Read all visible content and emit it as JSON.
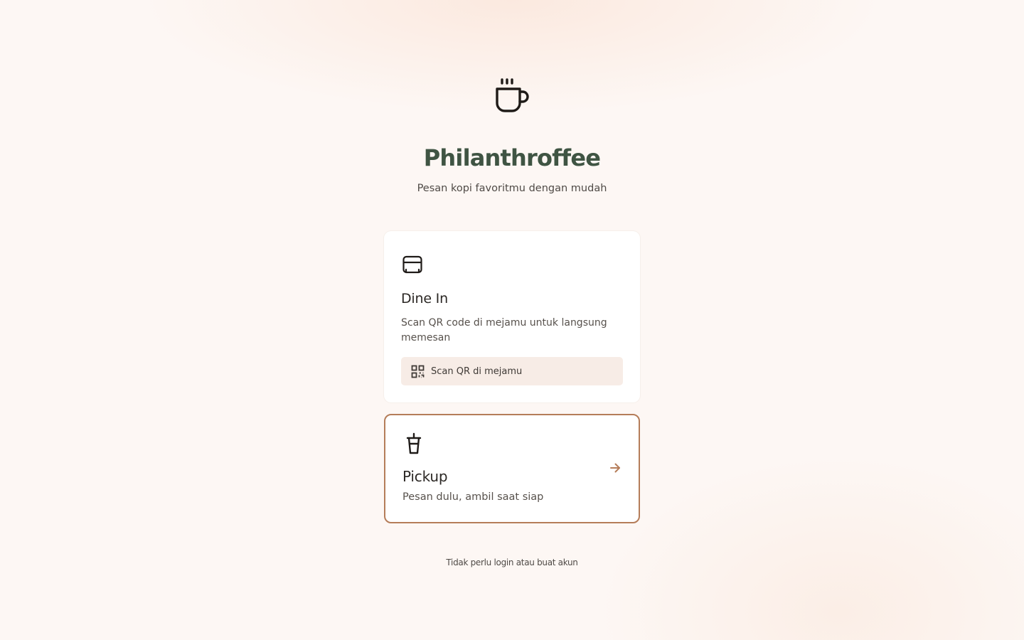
{
  "brand": {
    "name": "Philanthroffee",
    "tagline": "Pesan kopi favoritmu dengan mudah",
    "logo_icon": "coffee-cup-icon"
  },
  "options": {
    "dine_in": {
      "title": "Dine In",
      "description": "Scan QR code di mejamu untuk langsung memesan",
      "icon": "table-icon",
      "action_label": "Scan QR di mejamu",
      "action_icon": "qr-code-icon"
    },
    "pickup": {
      "title": "Pickup",
      "description": "Pesan dulu, ambil saat siap",
      "icon": "takeaway-cup-icon",
      "arrow_icon": "arrow-right-icon"
    }
  },
  "footer": {
    "note": "Tidak perlu login atau buat akun"
  },
  "colors": {
    "brand_green": "#3f5443",
    "accent_brown": "#b57d59",
    "background": "#fdf7f4",
    "button_bg": "#f7ece6"
  }
}
